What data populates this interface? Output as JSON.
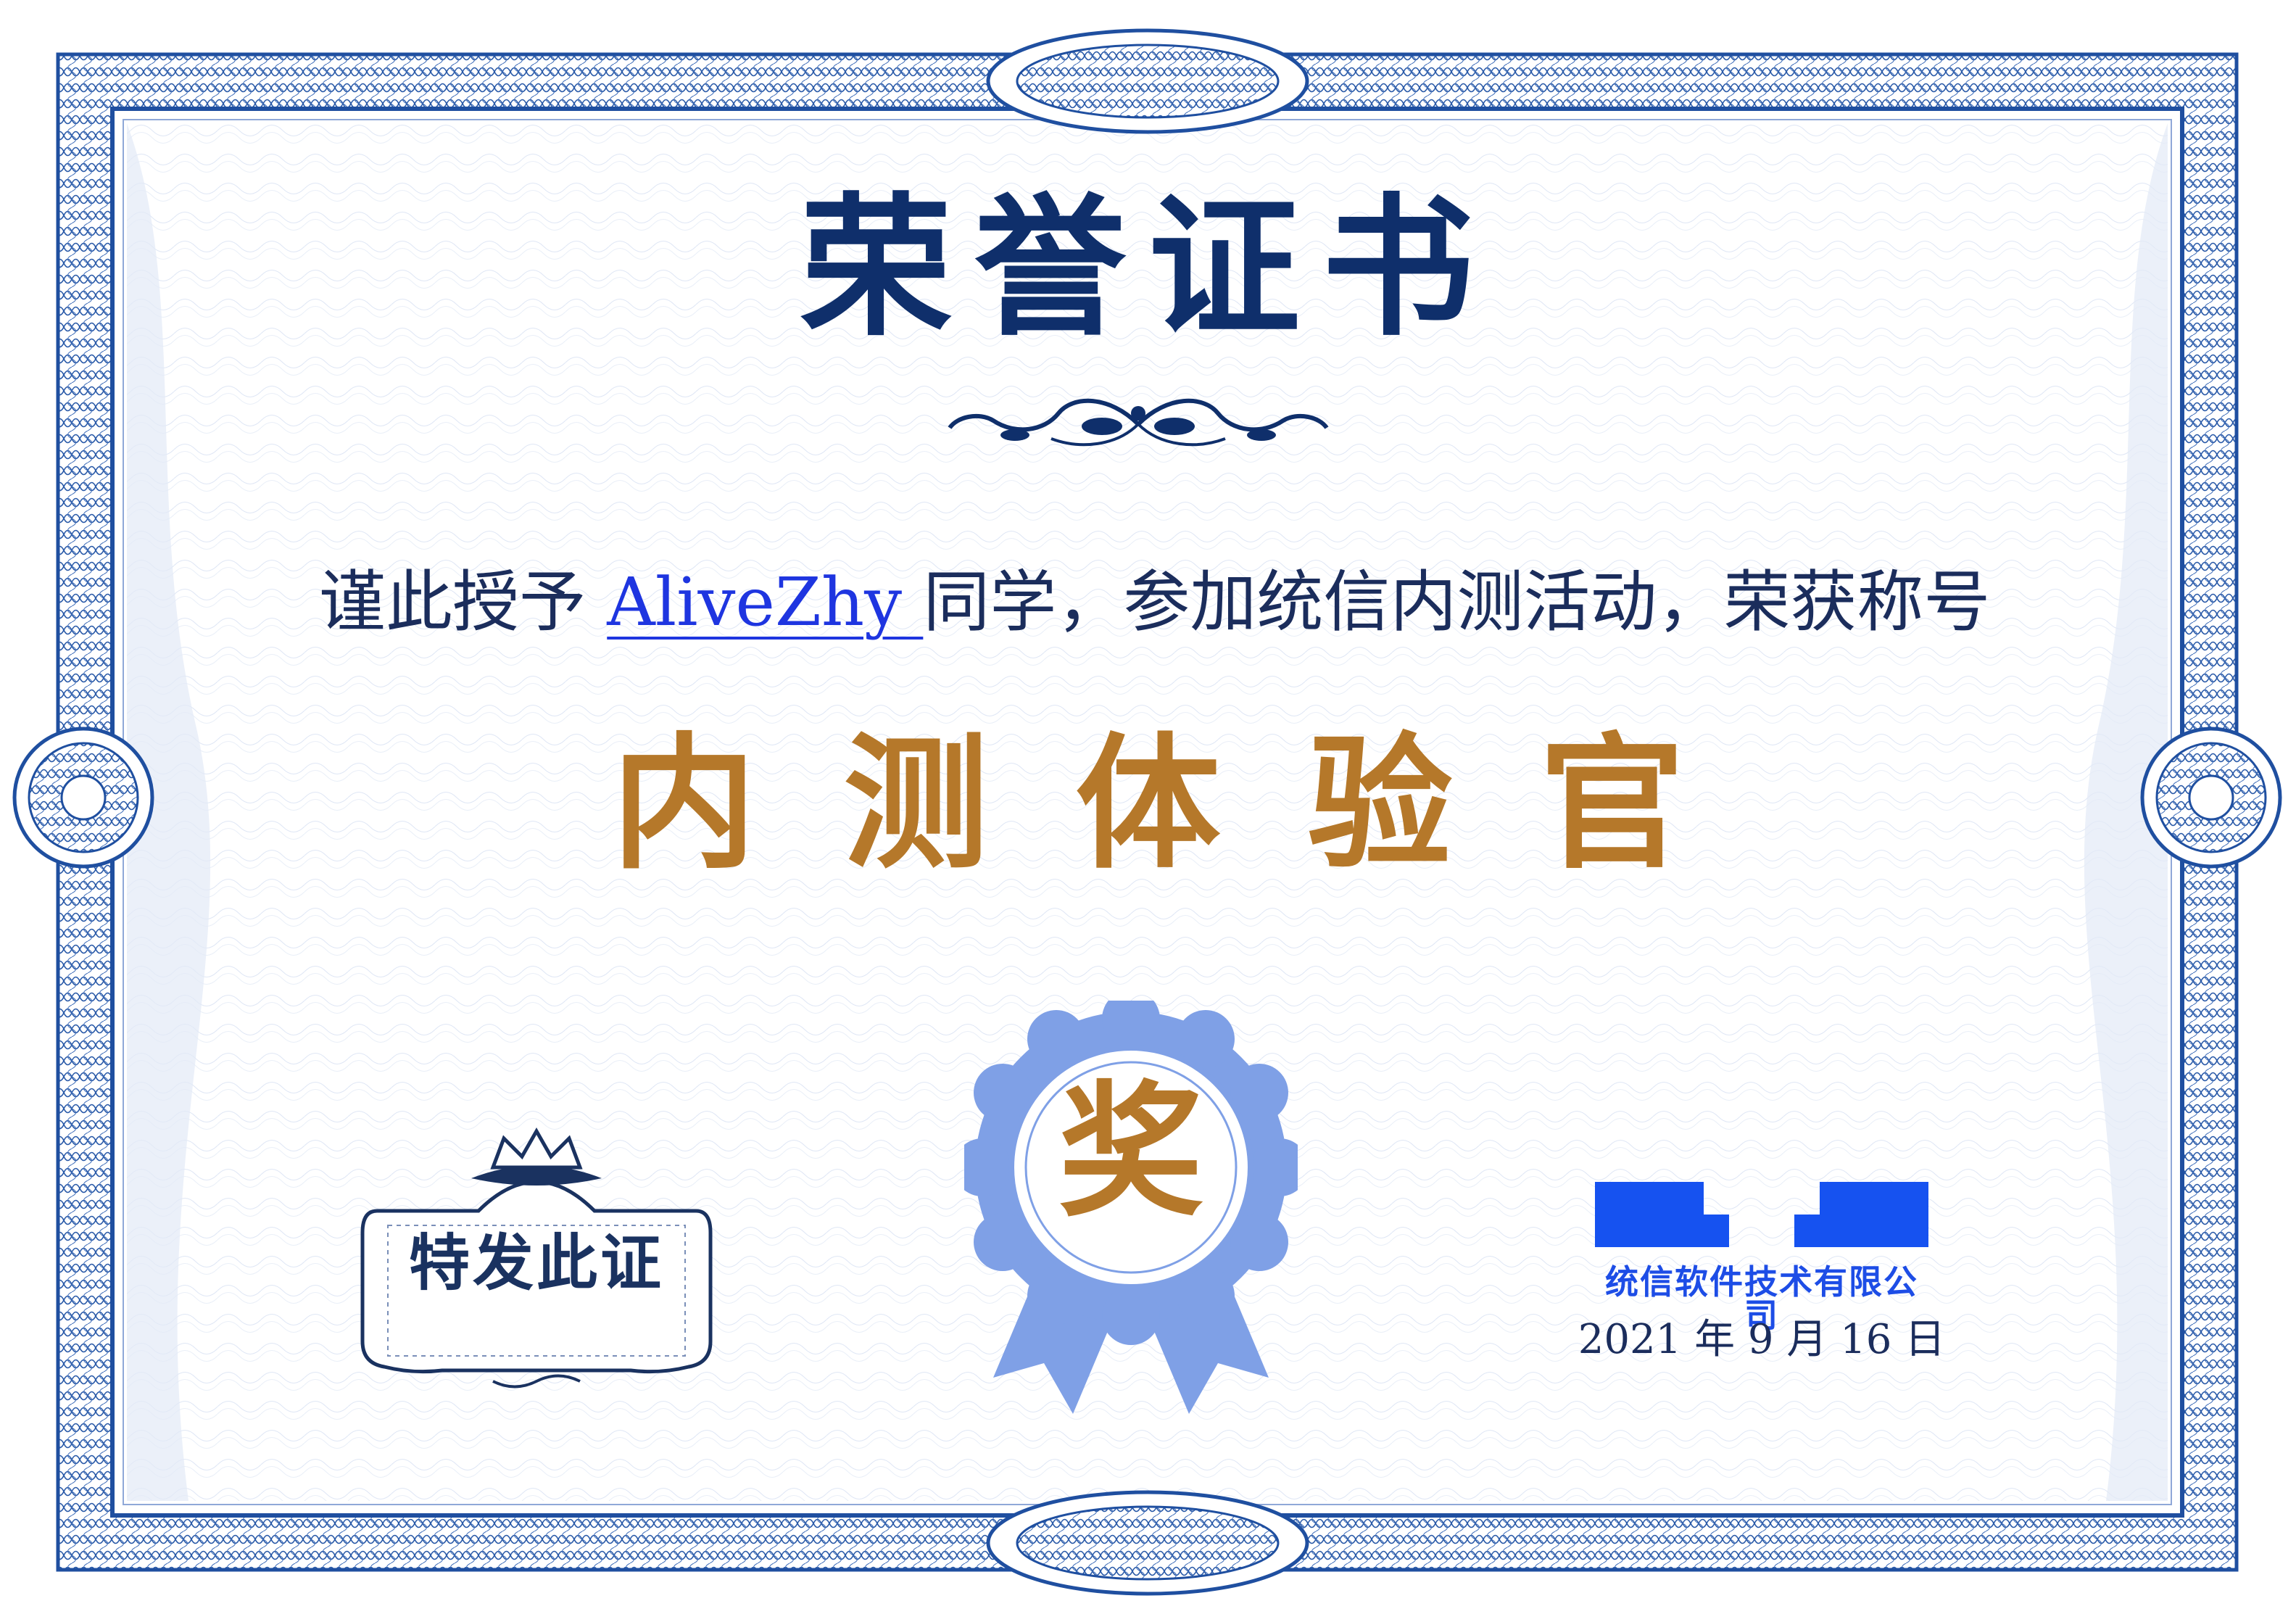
{
  "certificate": {
    "title": "荣誉证书",
    "award_prefix": "谨此授予 ",
    "recipient": "AliveZhy ",
    "award_suffix": "同学，参加统信内测活动，荣获称号",
    "honor_title": "内测体验官",
    "plaque_text": "特发此证",
    "rosette_char": "奖",
    "company": "统信软件技术有限公司",
    "date": "2021 年 9 月 16 日"
  },
  "colors": {
    "title": "#0f2f6b",
    "border": "#1f4fa0",
    "honor": "#b5782a",
    "rosette": "#7fa0e6",
    "logo": "#1652f0"
  },
  "icons": {
    "title_ornament": "scroll-flourish-icon",
    "crown": "crown-icon",
    "rosette": "award-rosette-icon",
    "logo": "uos-logo-icon"
  }
}
